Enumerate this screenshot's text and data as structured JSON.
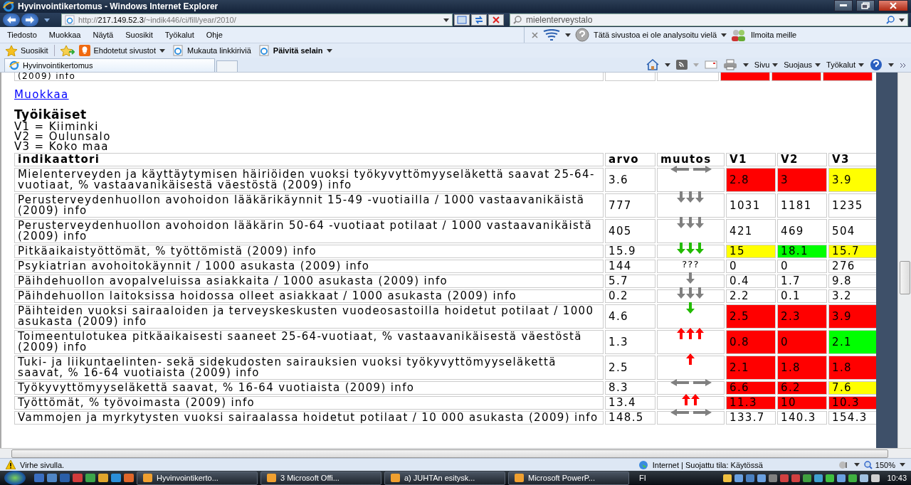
{
  "window": {
    "title": "Hyvinvointikertomus - Windows Internet Explorer"
  },
  "address_bar": {
    "url": "http://**217.149.52.3**/~indik446/ci/fill/year/2010/"
  },
  "search": {
    "value": "mielenterveystalo"
  },
  "menu": [
    "Tiedosto",
    "Muokkaa",
    "Näytä",
    "Suosikit",
    "Työkalut",
    "Ohje"
  ],
  "security_toolbar": {
    "status": "Tätä sivustoa ei ole analysoitu vielä",
    "report": "Ilmoita meille"
  },
  "favorites_bar": {
    "favorites": "Suosikit",
    "items": [
      {
        "label": "Ehdotetut sivustot",
        "kind": "suggested"
      },
      {
        "label": "Mukauta linkkiriviä",
        "kind": "link"
      },
      {
        "label": "Päivitä selain",
        "kind": "update"
      }
    ]
  },
  "tabs": [
    {
      "label": "Hyvinvointikertomus",
      "selected": true
    }
  ],
  "command_bar": [
    "Sivu",
    "Suojaus",
    "Työkalut"
  ],
  "page": {
    "previous_row": {
      "text": "(2009) info",
      "cells": [
        {
          "color": "#ff0000"
        },
        {
          "color": "#ff0000"
        },
        {
          "color": "#ff0000"
        }
      ]
    },
    "edit_link": "Muokkaa",
    "heading": "Työikäiset",
    "legend": [
      "V1 = Kiiminki",
      "V2 = Oulunsalo",
      "V3 = Koko maa"
    ],
    "table": {
      "columns": [
        "indikaattori",
        "arvo",
        "muutos",
        "V1",
        "V2",
        "V3"
      ],
      "rows": [
        {
          "indicator": "Mielenterveyden ja käyttäytymisen häiriöiden vuoksi työkyvyttömyyseläkettä saavat 25-64-vuotiaat, % vastaavanikäisestä väestöstä (2009) info",
          "value": "3.6",
          "change": {
            "kind": "horizontal",
            "color": "#808080"
          },
          "v": [
            {
              "text": "2.8",
              "color": "#ff0000"
            },
            {
              "text": "3",
              "color": "#ff0000"
            },
            {
              "text": "3.9",
              "color": "#ffff00"
            }
          ]
        },
        {
          "indicator": "Perusterveydenhuollon avohoidon lääkärikäynnit 15-49 -vuotiailla / 1000 vastaavanikäistä (2009) info",
          "value": "777",
          "change": {
            "kind": "down_triple",
            "color": "#808080"
          },
          "v": [
            {
              "text": "1031"
            },
            {
              "text": "1181"
            },
            {
              "text": "1235"
            }
          ]
        },
        {
          "indicator": "Perusterveydenhuollon avohoidon lääkärin 50-64 -vuotiaat potilaat / 1000 vastaavanikäistä (2009) info",
          "value": "405",
          "change": {
            "kind": "down_triple",
            "color": "#808080"
          },
          "v": [
            {
              "text": "421"
            },
            {
              "text": "469"
            },
            {
              "text": "504"
            }
          ]
        },
        {
          "indicator": "Pitkäaikaistyöttömät, % työttömistä (2009) info",
          "value": "15.9",
          "change": {
            "kind": "down_triple",
            "color": "#22bb00"
          },
          "v": [
            {
              "text": "15",
              "color": "#ffff00"
            },
            {
              "text": "18.1",
              "color": "#00ff00"
            },
            {
              "text": "15.7",
              "color": "#ffff00"
            }
          ]
        },
        {
          "indicator": "Psykiatrian avohoitokäynnit / 1000 asukasta (2009) info",
          "value": "144",
          "change": {
            "kind": "unknown",
            "text": "???"
          },
          "v": [
            {
              "text": "0"
            },
            {
              "text": "0"
            },
            {
              "text": "276"
            }
          ]
        },
        {
          "indicator": "Päihdehuollon avopalveluissa asiakkaita / 1000 asukasta (2009) info",
          "value": "5.7",
          "change": {
            "kind": "down_single",
            "color": "#808080"
          },
          "v": [
            {
              "text": "0.4"
            },
            {
              "text": "1.7"
            },
            {
              "text": "9.8"
            }
          ]
        },
        {
          "indicator": "Päihdehuollon laitoksissa hoidossa olleet asiakkaat / 1000 asukasta (2009) info",
          "value": "0.2",
          "change": {
            "kind": "down_triple",
            "color": "#808080"
          },
          "v": [
            {
              "text": "2.2"
            },
            {
              "text": "0.1"
            },
            {
              "text": "3.2"
            }
          ]
        },
        {
          "indicator": "Päihteiden vuoksi sairaaloiden ja terveyskeskusten vuodeosastoilla hoidetut potilaat / 1000 asukasta (2009) info",
          "value": "4.6",
          "change": {
            "kind": "down_single",
            "color": "#22bb00"
          },
          "v": [
            {
              "text": "2.5",
              "color": "#ff0000"
            },
            {
              "text": "2.3",
              "color": "#ff0000"
            },
            {
              "text": "3.9",
              "color": "#ff0000"
            }
          ]
        },
        {
          "indicator": "Toimeentulotukea pitkäaikaisesti saaneet 25-64-vuotiaat, % vastaavanikäisestä väestöstä (2009) info",
          "value": "1.3",
          "change": {
            "kind": "up_triple",
            "color": "#ff0000"
          },
          "v": [
            {
              "text": "0.8",
              "color": "#ff0000"
            },
            {
              "text": "0",
              "color": "#ff0000"
            },
            {
              "text": "2.1",
              "color": "#00ff00"
            }
          ]
        },
        {
          "indicator": "Tuki- ja liikuntaelinten- sekä sidekudosten sairauksien vuoksi työkyvyttömyyseläkettä saavat, % 16-64 vuotiaista (2009) info",
          "value": "2.5",
          "change": {
            "kind": "up_single",
            "color": "#ff0000"
          },
          "v": [
            {
              "text": "2.1",
              "color": "#ff0000"
            },
            {
              "text": "1.8",
              "color": "#ff0000"
            },
            {
              "text": "1.8",
              "color": "#ff0000"
            }
          ]
        },
        {
          "indicator": "Työkyvyttömyyseläkettä saavat, % 16-64 vuotiaista (2009) info",
          "value": "8.3",
          "change": {
            "kind": "horizontal",
            "color": "#808080"
          },
          "v": [
            {
              "text": "6.6",
              "color": "#ff0000"
            },
            {
              "text": "6.2",
              "color": "#ff0000"
            },
            {
              "text": "7.6",
              "color": "#ffff00"
            }
          ]
        },
        {
          "indicator": "Työttömät, % työvoimasta (2009) info",
          "value": "13.4",
          "change": {
            "kind": "up_double",
            "color": "#ff0000"
          },
          "v": [
            {
              "text": "11.3",
              "color": "#ff0000"
            },
            {
              "text": "10",
              "color": "#ff0000"
            },
            {
              "text": "10.3",
              "color": "#ff0000"
            }
          ]
        },
        {
          "indicator": "Vammojen ja myrkytysten vuoksi sairaalassa hoidetut potilaat / 10 000 asukasta (2009) info",
          "value": "148.5",
          "change": {
            "kind": "horizontal",
            "color": "#808080"
          },
          "v": [
            {
              "text": "133.7"
            },
            {
              "text": "140.3"
            },
            {
              "text": "154.3"
            }
          ]
        }
      ]
    }
  },
  "status_bar": {
    "message": "Virhe sivulla.",
    "zone": "Internet | Suojattu tila: Käytössä",
    "zoom": "150%"
  },
  "taskbar": {
    "tasks": [
      "Hyvinvointikerto...",
      "3 Microsoft Offi...",
      "a) JUHTAn esitysk...",
      "Microsoft PowerP..."
    ],
    "language": "FI",
    "clock": "10:43"
  }
}
